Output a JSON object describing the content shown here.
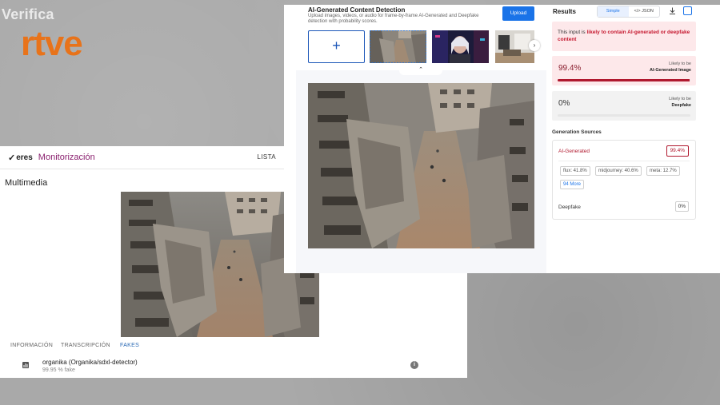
{
  "branding": {
    "verifica": "Verifica",
    "rtve": "rtve"
  },
  "veres": {
    "logo": "eres",
    "app_title": "Monitorización",
    "nav_link": "LISTA",
    "section_title": "Multimedia",
    "tabs": [
      "INFORMACIÓN",
      "TRANSCRIPCIÓN",
      "FAKES"
    ],
    "active_tab": "FAKES",
    "detector": {
      "name": "organika (Organika/sdxl-detector)",
      "score": "99.95 % fake"
    }
  },
  "detector_app": {
    "title": "AI-Generated Content Detection",
    "subtitle": "Upload images, videos, or audio for frame-by-frame AI-Generated and Deepfake detection with probability scores.",
    "upload_label": "Upload",
    "add_label": "+",
    "results": {
      "title": "Results",
      "view_simple": "Simple",
      "view_json": "</> JSON",
      "verdict_prefix": "This input is ",
      "verdict_emphasis": "likely to contain AI-generated or deepfake content",
      "ai_generated": {
        "value": "99.4%",
        "fraction": 0.994,
        "label_top": "Likely to be",
        "label_bottom": "AI-Generated Image"
      },
      "deepfake": {
        "value": "0%",
        "fraction": 0.0,
        "label_top": "Likely to be",
        "label_bottom": "Deepfake"
      },
      "generation_sources": {
        "title": "Generation Sources",
        "ai_label": "AI-Generated",
        "ai_value": "99.4%",
        "chips": [
          "flux: 41.8%",
          "midjourney: 40.6%",
          "meta: 12.7%"
        ],
        "more": "94 More",
        "deepfake_label": "Deepfake",
        "deepfake_value": "0%"
      }
    }
  },
  "colors": {
    "rtve_orange": "#e8731a",
    "veres_purple": "#8a1f6e",
    "upload_blue": "#1a73e8",
    "alert_red": "#b0182e",
    "alert_bg": "#fde8ea"
  }
}
